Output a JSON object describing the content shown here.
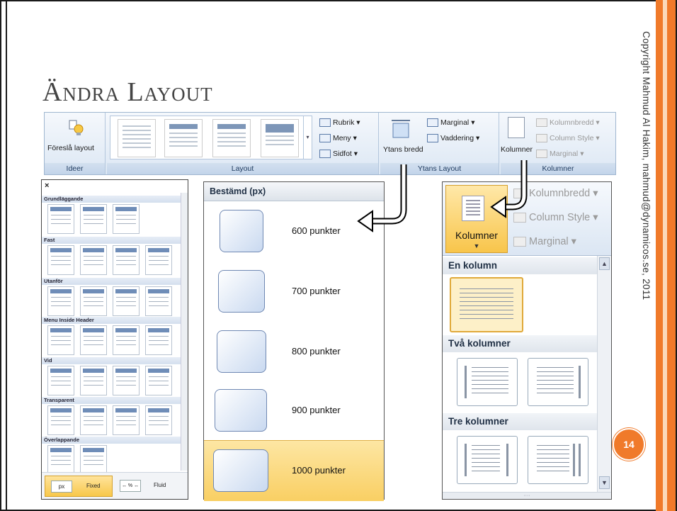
{
  "slide": {
    "title": "Ändra Layout",
    "copyright": "Copyright Mahmud Al Hakim, mahmud@dynamicos.se, 2011",
    "page_number": "14",
    "accent_color": "#f07a2a"
  },
  "ribbon": {
    "groups": {
      "ideer": {
        "label": "Ideer",
        "button": "Föreslå layout"
      },
      "layout": {
        "label": "Layout",
        "rubrik": "Rubrik",
        "meny": "Meny",
        "sidfot": "Sidfot"
      },
      "ytans_layout": {
        "label": "Ytans Layout",
        "ytans_bredd": "Ytans bredd",
        "marginal": "Marginal",
        "vaddering": "Vaddering"
      },
      "kolumner": {
        "label": "Kolumner",
        "kolumner_button": "Kolumner",
        "kolumnbredd": "Kolumnbredd",
        "column_style": "Column Style",
        "marginal": "Marginal"
      }
    }
  },
  "palette": {
    "close": "×",
    "categories": [
      "Grundläggande",
      "Fast",
      "Utanför",
      "Menu Inside Header",
      "Vid",
      "Transparent",
      "Överlappande"
    ],
    "footer": {
      "fixed_chip": "px",
      "fixed_label": "Fixed",
      "fluid_chip": "↔ % ↔",
      "fluid_label": "Fluid"
    }
  },
  "widths": {
    "header": "Bestämd (px)",
    "options": [
      "600 punkter",
      "700 punkter",
      "800 punkter",
      "900 punkter",
      "1000 punkter"
    ],
    "selected": "1000 punkter"
  },
  "columns_panel": {
    "button": "Kolumner",
    "kolumnbredd": "Kolumnbredd",
    "column_style": "Column Style",
    "marginal": "Marginal",
    "categories": [
      "En kolumn",
      "Två kolumner",
      "Tre kolumner"
    ],
    "selected": "En kolumn"
  }
}
